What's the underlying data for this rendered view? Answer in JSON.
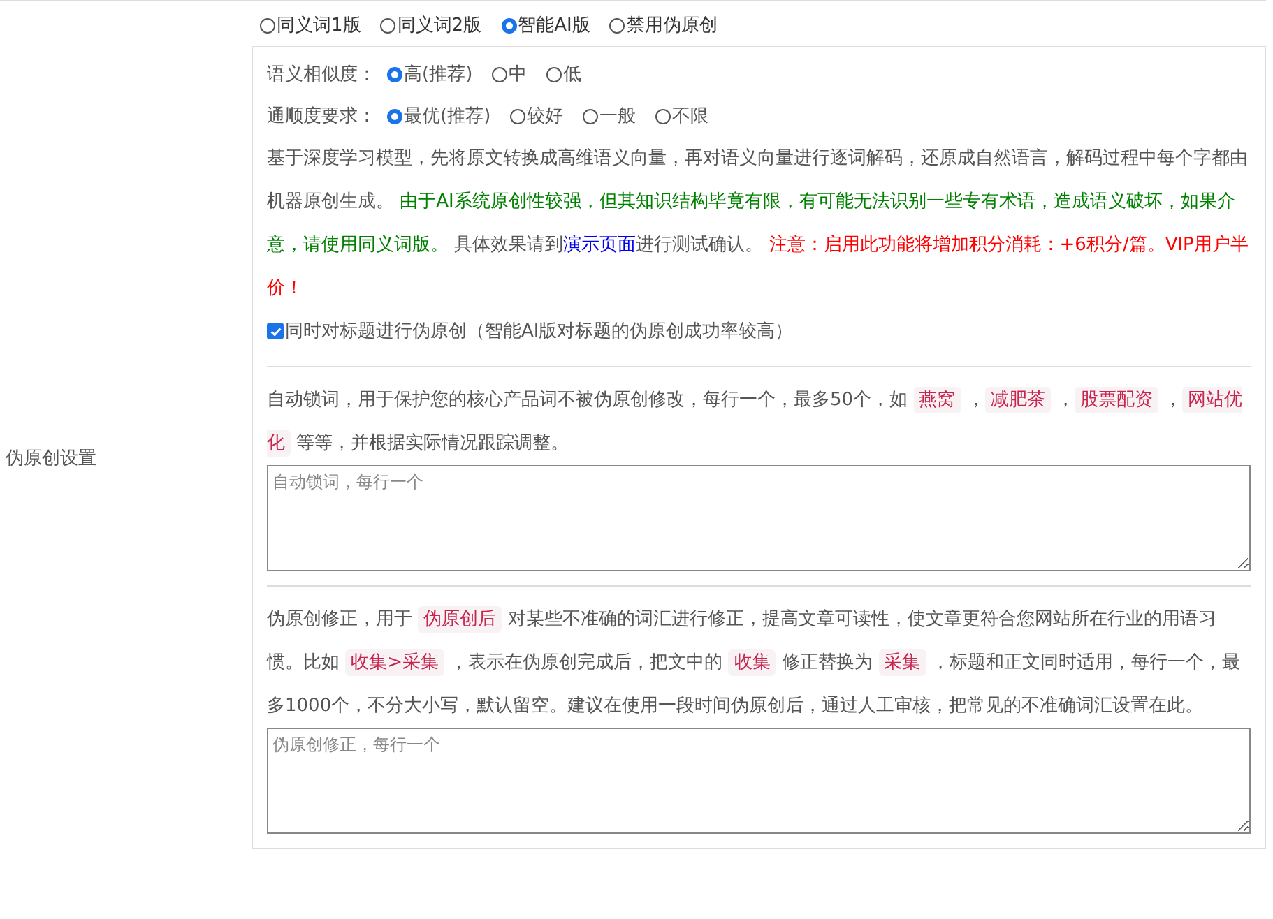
{
  "side_label": "伪原创设置",
  "modes": [
    {
      "label": "同义词1版",
      "selected": false
    },
    {
      "label": "同义词2版",
      "selected": false
    },
    {
      "label": "智能AI版",
      "selected": true
    },
    {
      "label": "禁用伪原创",
      "selected": false
    }
  ],
  "options": [
    {
      "label": "语义相似度：",
      "choices": [
        {
          "label": "高(推荐)",
          "selected": true
        },
        {
          "label": "中",
          "selected": false
        },
        {
          "label": "低",
          "selected": false
        }
      ]
    },
    {
      "label": "通顺度要求：",
      "choices": [
        {
          "label": "最优(推荐)",
          "selected": true
        },
        {
          "label": "较好",
          "selected": false
        },
        {
          "label": "一般",
          "selected": false
        },
        {
          "label": "不限",
          "selected": false
        }
      ]
    }
  ],
  "ai_description": [
    {
      "kind": "plain",
      "text": "基于深度学习模型，先将原文转换成高维语义向量，再对语义向量进行逐词解码，还原成自然语言，解码过程中每个字都由机器原创生成。 "
    },
    {
      "kind": "green",
      "text": "由于AI系统原创性较强，但其知识结构毕竟有限，有可能无法识别一些专有术语，造成语义破坏，如果介意，请使用同义词版。"
    },
    {
      "kind": "plain",
      "text": " 具体效果请到"
    },
    {
      "kind": "link",
      "text": "演示页面"
    },
    {
      "kind": "plain",
      "text": "进行测试确认。 "
    },
    {
      "kind": "red",
      "text": "注意：启用此功能将增加积分消耗：+6积分/篇。VIP用户半价！"
    }
  ],
  "title_option": {
    "label": "同时对标题进行伪原创（智能AI版对标题的伪原创成功率较高）",
    "checked": true
  },
  "sections": [
    {
      "description": [
        {
          "kind": "plain",
          "text": "自动锁词，用于保护您的核心产品词不被伪原创修改，每行一个，最多50个，如 "
        },
        {
          "kind": "code",
          "text": "燕窝"
        },
        {
          "kind": "plain",
          "text": " ，"
        },
        {
          "kind": "code",
          "text": "减肥茶"
        },
        {
          "kind": "plain",
          "text": " ，"
        },
        {
          "kind": "code",
          "text": "股票配资"
        },
        {
          "kind": "plain",
          "text": " ，"
        },
        {
          "kind": "code",
          "text": "网站优化"
        },
        {
          "kind": "plain",
          "text": " 等等，并根据实际情况跟踪调整。"
        }
      ],
      "placeholder": "自动锁词，每行一个"
    },
    {
      "description": [
        {
          "kind": "plain",
          "text": "伪原创修正，用于 "
        },
        {
          "kind": "code",
          "text": "伪原创后"
        },
        {
          "kind": "plain",
          "text": " 对某些不准确的词汇进行修正，提高文章可读性，使文章更符合您网站所在行业的用语习惯。比如 "
        },
        {
          "kind": "code",
          "text": "收集>采集"
        },
        {
          "kind": "plain",
          "text": " ，表示在伪原创完成后，把文中的 "
        },
        {
          "kind": "code",
          "text": "收集"
        },
        {
          "kind": "plain",
          "text": " 修正替换为 "
        },
        {
          "kind": "code",
          "text": "采集"
        },
        {
          "kind": "plain",
          "text": " ，标题和正文同时适用，每行一个，最多1000个，不分大小写，默认留空。建议在使用一段时间伪原创后，通过人工审核，把常见的不准确词汇设置在此。"
        }
      ],
      "placeholder": "伪原创修正，每行一个"
    }
  ]
}
